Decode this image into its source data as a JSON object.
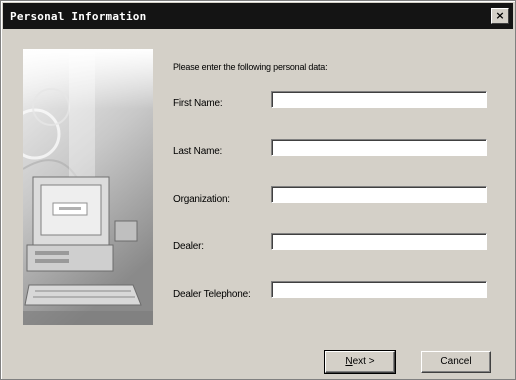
{
  "window": {
    "title": "Personal Information",
    "close_glyph": "×"
  },
  "prompt": "Please enter the following personal data:",
  "fields": [
    {
      "label": "First Name:",
      "value": ""
    },
    {
      "label": "Last Name:",
      "value": ""
    },
    {
      "label": "Organization:",
      "value": ""
    },
    {
      "label": "Dealer:",
      "value": ""
    },
    {
      "label": "Dealer Telephone:",
      "value": ""
    }
  ],
  "buttons": {
    "next_mnemonic": "N",
    "next_rest": "ext >",
    "cancel": "Cancel"
  },
  "illustration": {
    "icon": "computer-icon"
  }
}
